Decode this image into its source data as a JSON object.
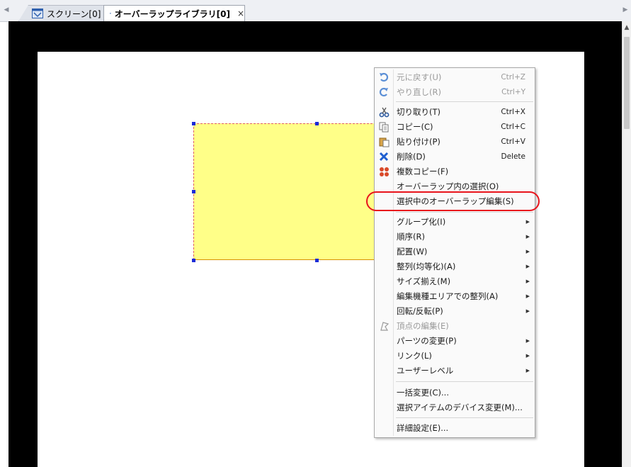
{
  "tabs": [
    {
      "label": "スクリーン[0]",
      "icon": "screen-tab-icon",
      "active": false
    },
    {
      "label": "オーバーラップライブラリ[0]",
      "icon": "overlap-library-tab-icon",
      "active": true
    }
  ],
  "tab_close_glyph": "×",
  "colors": {
    "canvas_background": "#000000",
    "page_background": "#ffffff",
    "shape_fill": "#ffff88",
    "selection_handle": "#1a2bd8",
    "highlight_ring": "#e8141c"
  },
  "context_menu": {
    "items": [
      {
        "label": "元に戻す(U)",
        "shortcut": "Ctrl+Z",
        "icon": "undo-icon",
        "disabled": true
      },
      {
        "label": "やり直し(R)",
        "shortcut": "Ctrl+Y",
        "icon": "redo-icon",
        "disabled": true
      },
      {
        "label": "切り取り(T)",
        "shortcut": "Ctrl+X",
        "icon": "scissors-icon"
      },
      {
        "label": "コピー(C)",
        "shortcut": "Ctrl+C",
        "icon": "copy-icon"
      },
      {
        "label": "貼り付け(P)",
        "shortcut": "Ctrl+V",
        "icon": "paste-icon"
      },
      {
        "label": "削除(D)",
        "shortcut": "Delete",
        "icon": "delete-x-icon"
      },
      {
        "label": "複数コピー(F)",
        "icon": "multi-copy-icon"
      },
      {
        "label": "オーバーラップ内の選択(O)"
      },
      {
        "label": "選択中のオーバーラップ編集(S)",
        "highlighted": true
      },
      {
        "label": "グループ化(I)",
        "submenu": true
      },
      {
        "label": "順序(R)",
        "submenu": true
      },
      {
        "label": "配置(W)",
        "submenu": true
      },
      {
        "label": "整列(均等化)(A)",
        "submenu": true
      },
      {
        "label": "サイズ揃え(M)",
        "submenu": true
      },
      {
        "label": "編集機種エリアでの整列(A)",
        "submenu": true
      },
      {
        "label": "回転/反転(P)",
        "submenu": true
      },
      {
        "label": "頂点の編集(E)",
        "icon": "vertex-edit-icon",
        "disabled": true
      },
      {
        "label": "パーツの変更(P)",
        "submenu": true
      },
      {
        "label": "リンク(L)",
        "submenu": true
      },
      {
        "label": "ユーザーレベル",
        "submenu": true
      },
      {
        "label": "一括変更(C)..."
      },
      {
        "label": "選択アイテムのデバイス変更(M)..."
      },
      {
        "label": "詳細設定(E)..."
      }
    ]
  }
}
